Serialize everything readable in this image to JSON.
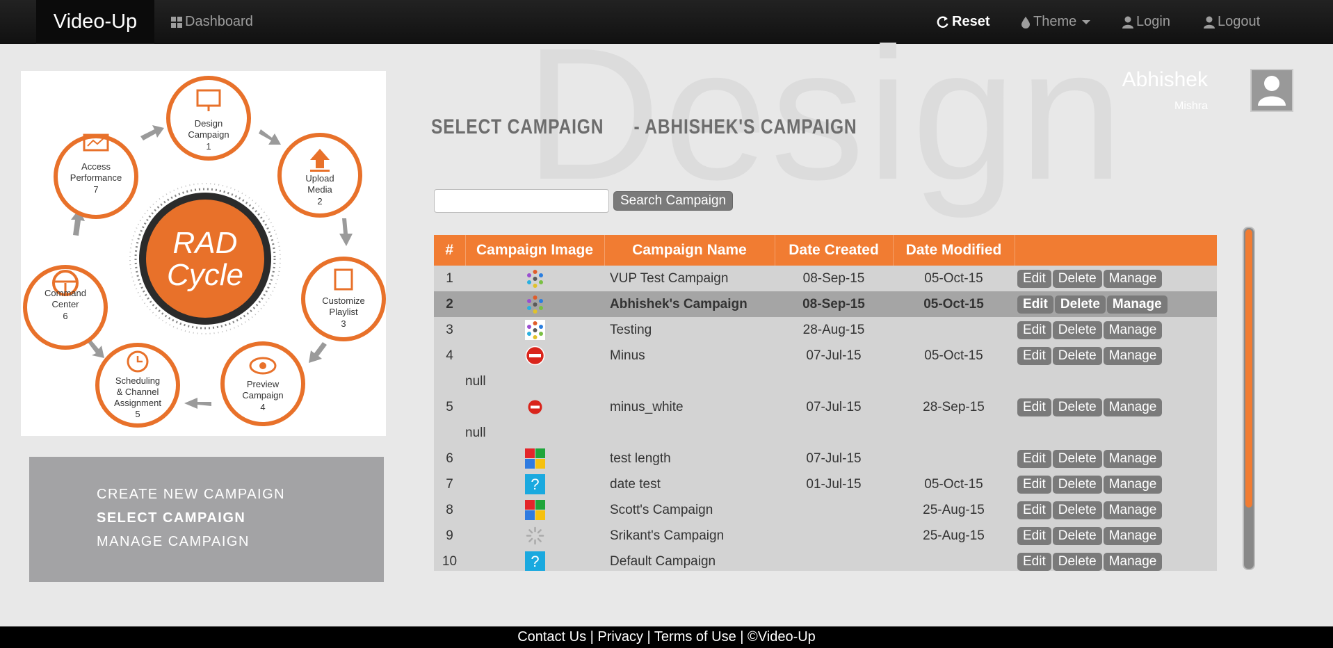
{
  "nav": {
    "brand": "Video-Up",
    "dashboard": "Dashboard",
    "reset": "Reset",
    "theme": "Theme",
    "login": "Login",
    "logout": "Logout"
  },
  "watermark": "Design",
  "user": {
    "first_name": "Abhishek",
    "last_name": "Mishra"
  },
  "page": {
    "title": "SELECT CAMPAIGN",
    "subtitle": "- ABHISHEK'S CAMPAIGN"
  },
  "search": {
    "button": "Search Campaign",
    "value": ""
  },
  "rad_cycle": {
    "center_line1": "RAD",
    "center_line2": "Cycle",
    "steps": [
      {
        "label1": "Design",
        "label2": "Campaign",
        "num": "1"
      },
      {
        "label1": "Upload",
        "label2": "Media",
        "num": "2"
      },
      {
        "label1": "Customize",
        "label2": "Playlist",
        "num": "3"
      },
      {
        "label1": "Preview",
        "label2": "Campaign",
        "num": "4"
      },
      {
        "label1": "Scheduling",
        "label2": "& Channel",
        "label3": "Assignment",
        "num": "5"
      },
      {
        "label1": "Command",
        "label2": "Center",
        "num": "6"
      },
      {
        "label1": "Access",
        "label2": "Performance",
        "num": "7"
      }
    ]
  },
  "menu": {
    "create": "CREATE NEW CAMPAIGN",
    "select": "SELECT CAMPAIGN",
    "manage": "MANAGE CAMPAIGN"
  },
  "table": {
    "headers": [
      "#",
      "Campaign Image",
      "Campaign Name",
      "Date Created",
      "Date Modified"
    ],
    "action_labels": {
      "edit": "Edit",
      "delete": "Delete",
      "manage": "Manage"
    },
    "rows": [
      {
        "num": "1",
        "icon": "dots-icon",
        "name": "VUP Test Campaign",
        "created": "08-Sep-15",
        "modified": "05-Oct-15"
      },
      {
        "num": "2",
        "icon": "dots-icon",
        "name": "Abhishek's Campaign",
        "created": "08-Sep-15",
        "modified": "05-Oct-15",
        "selected": true
      },
      {
        "num": "3",
        "icon": "dots-white-icon",
        "name": "Testing",
        "created": "28-Aug-15",
        "modified": ""
      },
      {
        "num": "4",
        "icon": "minus-icon",
        "name": "Minus",
        "created": "07-Jul-15",
        "modified": "05-Oct-15",
        "note": "null"
      },
      {
        "num": "5",
        "icon": "minus-small-icon",
        "name": "minus_white",
        "created": "07-Jul-15",
        "modified": "28-Sep-15",
        "note": "null"
      },
      {
        "num": "6",
        "icon": "windows-icon",
        "name": "test length",
        "created": "07-Jul-15",
        "modified": ""
      },
      {
        "num": "7",
        "icon": "question-icon",
        "name": "date test",
        "created": "01-Jul-15",
        "modified": "05-Oct-15"
      },
      {
        "num": "8",
        "icon": "windows-icon",
        "name": "Scott's Campaign",
        "created": "",
        "modified": "25-Aug-15"
      },
      {
        "num": "9",
        "icon": "spinner-icon",
        "name": "Srikant's Campaign",
        "created": "",
        "modified": "25-Aug-15"
      },
      {
        "num": "10",
        "icon": "question-icon",
        "name": "Default Campaign",
        "created": "",
        "modified": ""
      }
    ]
  },
  "footer": "Contact Us | Privacy | Terms of Use | ©Video-Up",
  "colors": {
    "accent": "#f17c32",
    "navbar": "#111111",
    "menu_panel": "#a3a3a5"
  }
}
